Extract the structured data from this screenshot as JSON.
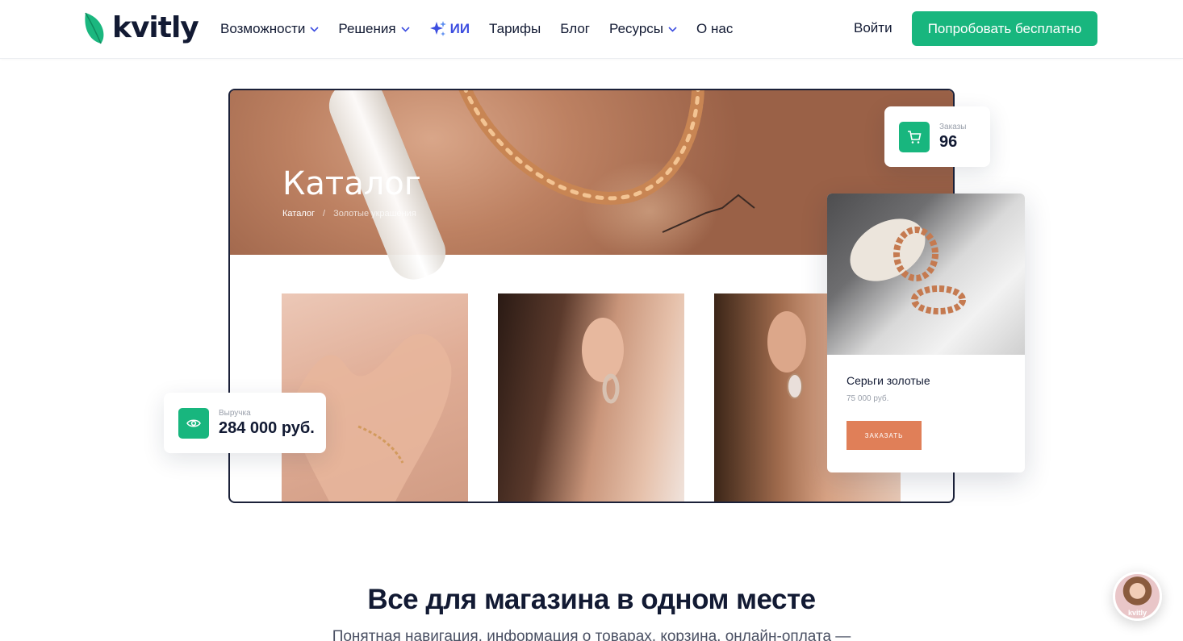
{
  "brand": {
    "name": "kvitly",
    "accent": "#18b67e",
    "dark": "#121a33",
    "ai_color": "#3d4ee0"
  },
  "nav": {
    "items": [
      {
        "label": "Возможности",
        "dropdown": true
      },
      {
        "label": "Решения",
        "dropdown": true
      },
      {
        "label": "ИИ",
        "icon": "sparkle-icon"
      },
      {
        "label": "Тарифы"
      },
      {
        "label": "Блог"
      },
      {
        "label": "Ресурсы",
        "dropdown": true
      },
      {
        "label": "О нас"
      }
    ],
    "login": "Войти",
    "cta": "Попробовать бесплатно"
  },
  "mockup": {
    "banner_title": "Каталог",
    "breadcrumb": [
      "Каталог",
      "/",
      "Золотые украшения"
    ],
    "orders": {
      "label": "Заказы",
      "value": "96",
      "icon": "cart-icon"
    },
    "revenue": {
      "label": "Выручка",
      "value": "284 000 руб.",
      "icon": "eye-icon"
    },
    "product": {
      "name": "Серьги золотые",
      "price": "75 000 руб.",
      "button": "ЗАКАЗАТЬ",
      "button_color": "#e07f58"
    }
  },
  "section": {
    "title": "Все для магазина в одном месте",
    "subtitle": "Понятная навигация, информация о товарах, корзина, онлайн-оплата —"
  },
  "chat_widget": {
    "label": "kvitly"
  }
}
